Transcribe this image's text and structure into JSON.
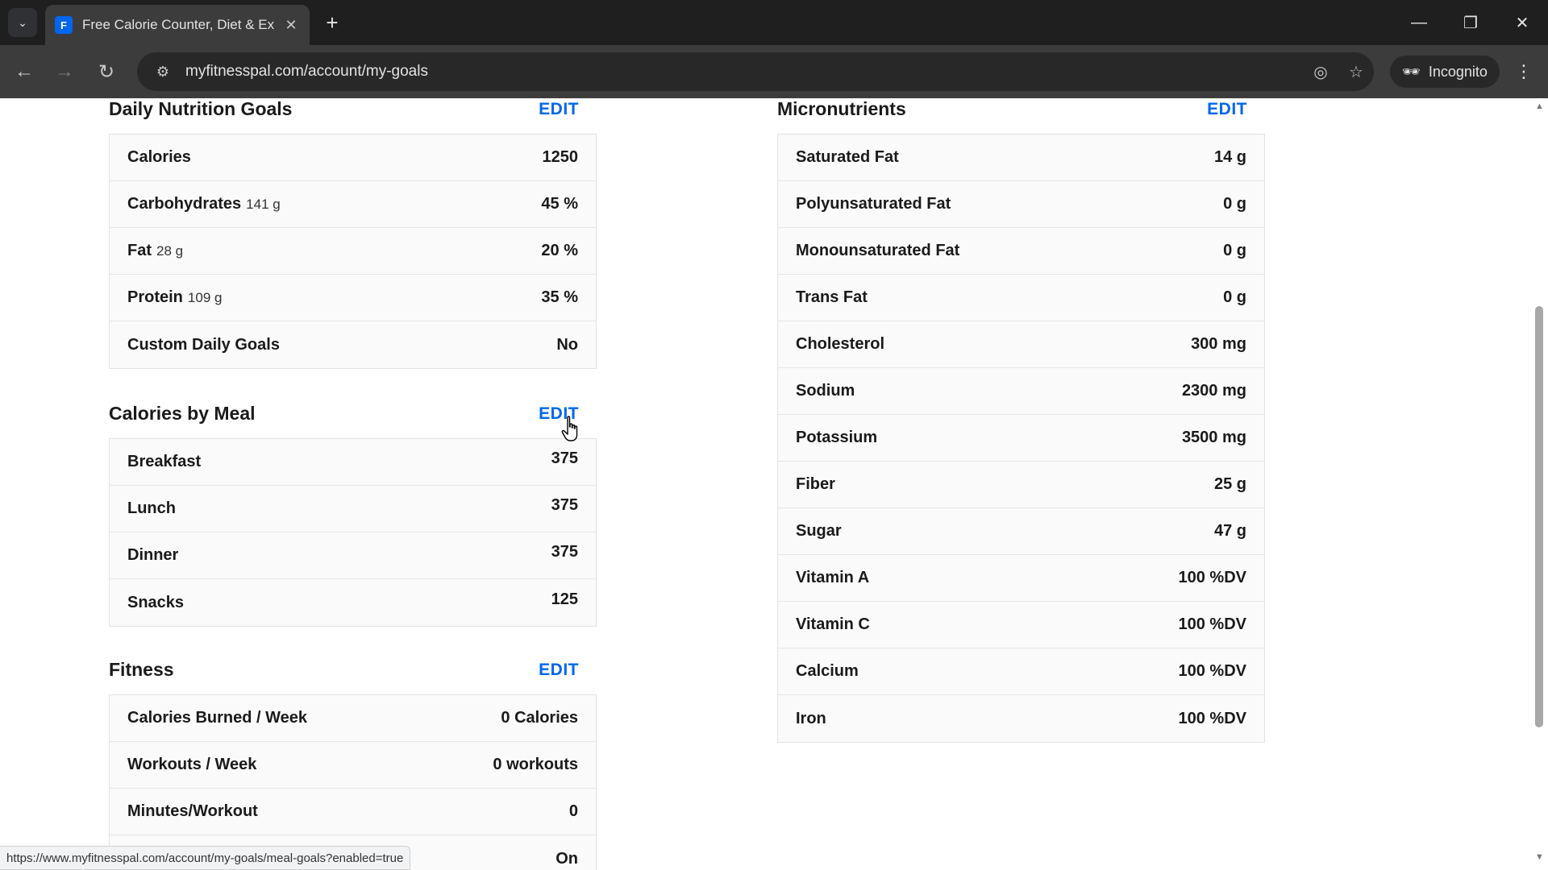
{
  "browser": {
    "tab_title": "Free Calorie Counter, Diet & Ex",
    "favicon_letter": "F",
    "url": "myfitnesspal.com/account/my-goals",
    "incognito_label": "Incognito",
    "status_url": "https://www.myfitnesspal.com/account/my-goals/meal-goals?enabled=true"
  },
  "edit_label": "EDIT",
  "daily_nutrition": {
    "title": "Daily Nutrition Goals",
    "rows": [
      {
        "label": "Calories",
        "sub": "",
        "value": "1250"
      },
      {
        "label": "Carbohydrates",
        "sub": "141 g",
        "value": "45 %"
      },
      {
        "label": "Fat",
        "sub": "28 g",
        "value": "20 %"
      },
      {
        "label": "Protein",
        "sub": "109 g",
        "value": "35 %"
      },
      {
        "label": "Custom Daily Goals",
        "sub": "",
        "value": "No"
      }
    ]
  },
  "calories_by_meal": {
    "title": "Calories by Meal",
    "rows": [
      {
        "label": "Breakfast",
        "value": "375"
      },
      {
        "label": "Lunch",
        "value": "375"
      },
      {
        "label": "Dinner",
        "value": "375"
      },
      {
        "label": "Snacks",
        "value": "125"
      }
    ]
  },
  "fitness": {
    "title": "Fitness",
    "rows": [
      {
        "label": "Calories Burned / Week",
        "value": "0 Calories"
      },
      {
        "label": "Workouts / Week",
        "value": "0 workouts"
      },
      {
        "label": "Minutes/Workout",
        "value": "0"
      },
      {
        "label": "",
        "value": "On"
      }
    ]
  },
  "micronutrients": {
    "title": "Micronutrients",
    "rows": [
      {
        "label": "Saturated Fat",
        "value": "14 g"
      },
      {
        "label": "Polyunsaturated Fat",
        "value": "0 g"
      },
      {
        "label": "Monounsaturated Fat",
        "value": "0 g"
      },
      {
        "label": "Trans Fat",
        "value": "0 g"
      },
      {
        "label": "Cholesterol",
        "value": "300 mg"
      },
      {
        "label": "Sodium",
        "value": "2300 mg"
      },
      {
        "label": "Potassium",
        "value": "3500 mg"
      },
      {
        "label": "Fiber",
        "value": "25 g"
      },
      {
        "label": "Sugar",
        "value": "47 g"
      },
      {
        "label": "Vitamin A",
        "value": "100 %DV"
      },
      {
        "label": "Vitamin C",
        "value": "100 %DV"
      },
      {
        "label": "Calcium",
        "value": "100 %DV"
      },
      {
        "label": "Iron",
        "value": "100 %DV"
      }
    ]
  }
}
